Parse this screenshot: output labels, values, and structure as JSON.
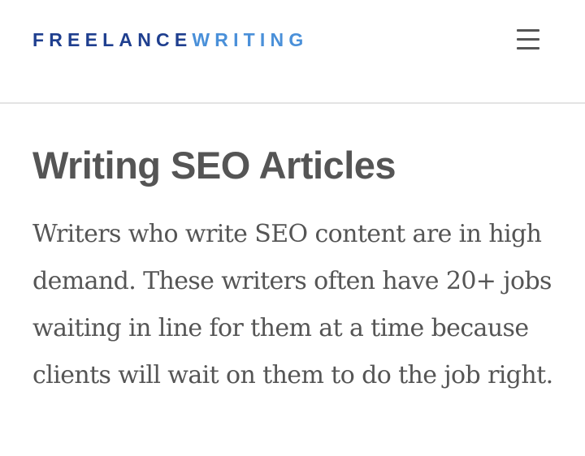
{
  "header": {
    "logo_part_1": "FREELANCE",
    "logo_part_2": "WRITING",
    "menu_icon": "hamburger-menu-icon"
  },
  "article": {
    "title": "Writing SEO Articles",
    "body": "Writers who write SEO content are in high demand. These writers often have 20+ jobs waiting in line for them at a time because clients will wait on them to do the job right."
  },
  "colors": {
    "logo_dark_blue": "#1f3f8f",
    "logo_light_blue": "#4a90d9",
    "text_gray": "#555555",
    "divider": "#e3e3e3"
  }
}
